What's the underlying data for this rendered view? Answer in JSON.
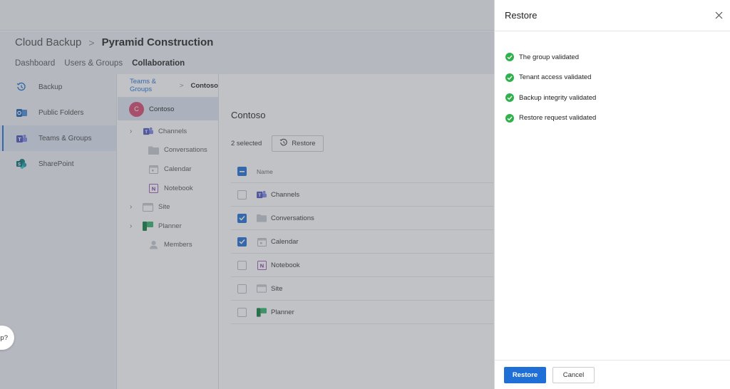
{
  "breadcrumb": {
    "root": "Cloud Backup",
    "separator": ">",
    "current": "Pyramid Construction"
  },
  "nav_tabs": [
    {
      "label": "Dashboard",
      "active": false
    },
    {
      "label": "Users & Groups",
      "active": false
    },
    {
      "label": "Collaboration",
      "active": true
    }
  ],
  "sidebar": {
    "items": [
      {
        "label": "Backup",
        "icon": "backup-icon",
        "active": false
      },
      {
        "label": "Public Folders",
        "icon": "outlook-icon",
        "active": false
      },
      {
        "label": "Teams & Groups",
        "icon": "teams-icon",
        "active": true
      },
      {
        "label": "SharePoint",
        "icon": "sharepoint-icon",
        "active": false
      }
    ]
  },
  "tree": {
    "path_root": "Teams & Groups",
    "path_sep": ">",
    "path_current": "Contoso",
    "selected": {
      "label": "Contoso",
      "avatar": "C"
    },
    "items": [
      {
        "label": "Channels",
        "expandable": true,
        "icon": "teams-icon"
      },
      {
        "label": "Conversations",
        "expandable": false,
        "icon": "folder-icon"
      },
      {
        "label": "Calendar",
        "expandable": false,
        "icon": "calendar-icon"
      },
      {
        "label": "Notebook",
        "expandable": false,
        "icon": "onenote-icon"
      },
      {
        "label": "Site",
        "expandable": true,
        "icon": "site-icon"
      },
      {
        "label": "Planner",
        "expandable": true,
        "icon": "planner-icon"
      },
      {
        "label": "Members",
        "expandable": false,
        "icon": "person-icon"
      }
    ]
  },
  "content": {
    "title": "Contoso",
    "selected_count": "2 selected",
    "restore_label": "Restore",
    "column_name": "Name",
    "rows": [
      {
        "label": "Channels",
        "icon": "teams-icon",
        "checked": false
      },
      {
        "label": "Conversations",
        "icon": "folder-icon",
        "checked": true
      },
      {
        "label": "Calendar",
        "icon": "calendar-icon",
        "checked": true
      },
      {
        "label": "Notebook",
        "icon": "onenote-icon",
        "checked": false
      },
      {
        "label": "Site",
        "icon": "site-icon",
        "checked": false
      },
      {
        "label": "Planner",
        "icon": "planner-icon",
        "checked": false
      }
    ]
  },
  "help": {
    "label": "lp?"
  },
  "panel": {
    "title": "Restore",
    "checks": [
      {
        "label": "The group validated"
      },
      {
        "label": "Tenant access validated"
      },
      {
        "label": "Backup integrity validated"
      },
      {
        "label": "Restore request validated"
      }
    ],
    "primary_label": "Restore",
    "secondary_label": "Cancel"
  },
  "colors": {
    "accent": "#1f6fd6",
    "success": "#2fb24c",
    "avatar": "#d9486f"
  }
}
